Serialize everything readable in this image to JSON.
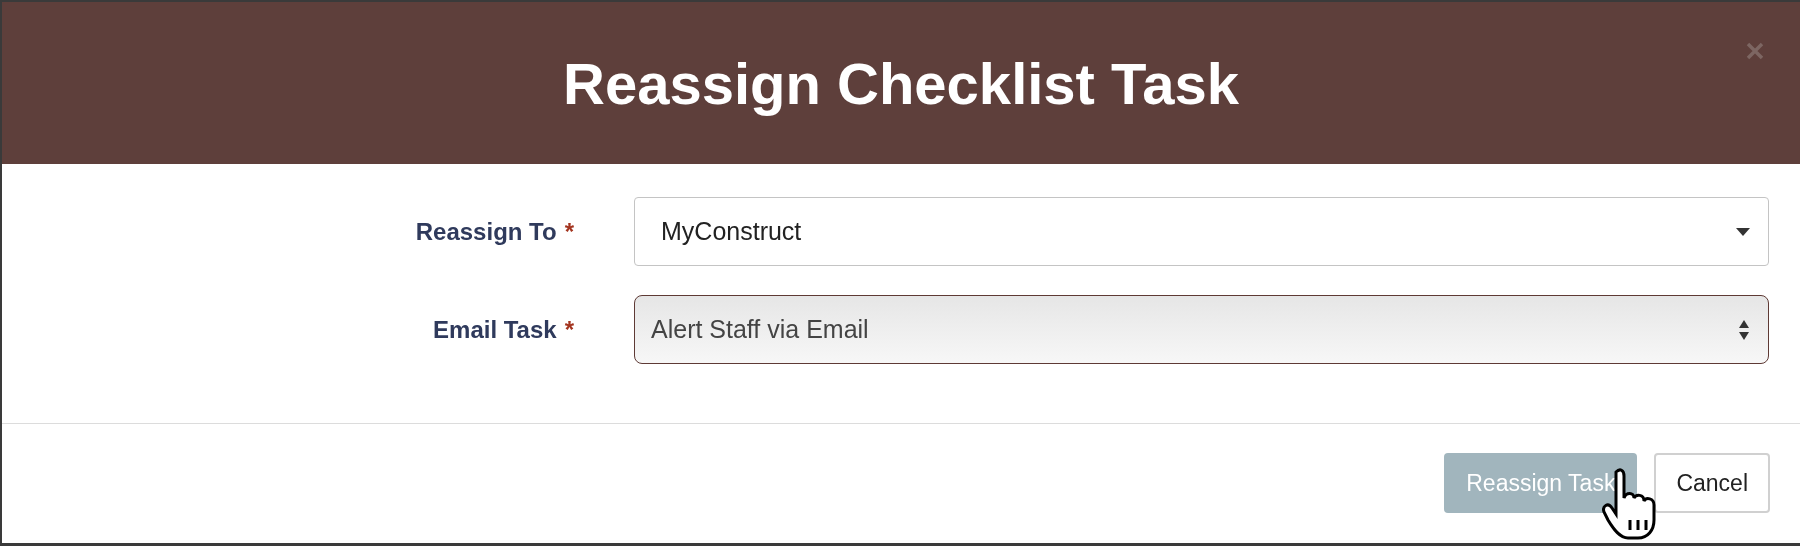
{
  "dialog": {
    "title": "Reassign Checklist Task",
    "fields": [
      {
        "kind": "dropdown",
        "label": "Reassign To",
        "required_mark": "*",
        "value": "MyConstruct",
        "focused": false
      },
      {
        "kind": "native-select",
        "label": "Email Task",
        "required_mark": "*",
        "value": "Alert Staff via Email",
        "focused": true
      }
    ],
    "buttons": [
      {
        "label": "Reassign Task",
        "kind": "primary"
      },
      {
        "label": "Cancel",
        "kind": "secondary"
      }
    ]
  }
}
